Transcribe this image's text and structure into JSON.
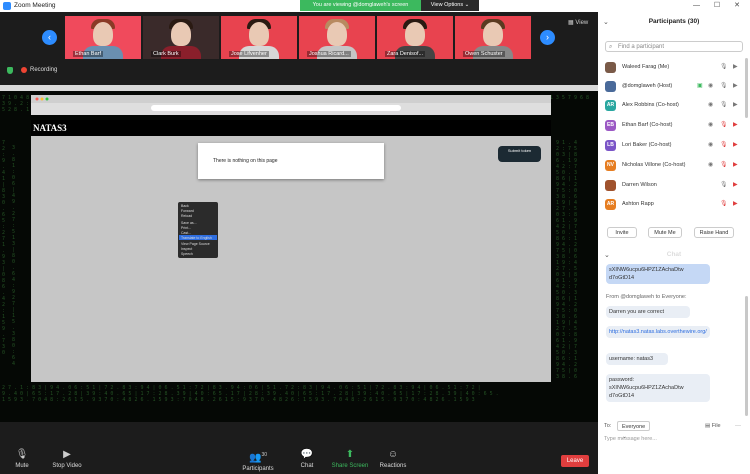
{
  "window": {
    "title": "Zoom Meeting",
    "controls": "— ☐ ✕"
  },
  "banner": {
    "viewing": "You are viewing @domglaweh's screen",
    "view_options": "View Options ⌄"
  },
  "gallery": {
    "tiles": [
      {
        "name": "Ethan Barf"
      },
      {
        "name": "Clark Burk"
      },
      {
        "name": "Jose Lifvenher"
      },
      {
        "name": "Joshua Ricard..."
      },
      {
        "name": "Zara Denisof..."
      },
      {
        "name": "Owen Schuster"
      }
    ],
    "view_label": "View"
  },
  "status": {
    "recording": "Recording"
  },
  "shared_screen": {
    "site_title": "NATAS3",
    "page_text": "There is nothing on this page",
    "submit_badge": "Submit token",
    "context_menu": [
      "Back",
      "Forward",
      "Reload",
      "Save as...",
      "Print...",
      "Cast...",
      "Translate to English",
      "View Page Source",
      "Inspect",
      "Speech"
    ]
  },
  "toolbar": {
    "mute": "Mute",
    "video": "Stop Video",
    "participants": "Participants",
    "participants_count": "30",
    "chat": "Chat",
    "share": "Share Screen",
    "reactions": "Reactions",
    "leave": "Leave"
  },
  "participants": {
    "title": "Participants (30)",
    "search_placeholder": "Find a participant",
    "list": [
      {
        "initials": "",
        "name": "Waleed Farag (Me)",
        "color": "#7a5a48"
      },
      {
        "initials": "",
        "name": "@domglaweh (Host)",
        "color": "#4a6a9a"
      },
      {
        "initials": "AR",
        "name": "Alex Robbins (Co-host)",
        "color": "#2aa7a0"
      },
      {
        "initials": "EB",
        "name": "Ethan Barf (Co-host)",
        "color": "#9b59c4"
      },
      {
        "initials": "LB",
        "name": "Lori Baker (Co-host)",
        "color": "#7b55c7"
      },
      {
        "initials": "NV",
        "name": "Nicholas Villone (Co-host)",
        "color": "#e67e22"
      },
      {
        "initials": "",
        "name": "Darren Wilson",
        "color": "#a0522d"
      },
      {
        "initials": "AR",
        "name": "Ashton Rapp",
        "color": "#e67e22"
      }
    ],
    "invite": "Invite",
    "mute_me": "Mute Me",
    "raise_hand": "Raise Hand"
  },
  "chat": {
    "title": "Chat",
    "msg1": "sXINW6ucpu6HPZ1ZAchaDtw d7oGtD14",
    "from": "From @domglaweh to Everyone:",
    "msg2": "Darren   you are correct",
    "msg3": "http://natas3.natas.labs.overthewire.org/",
    "msg4": "username: natas3",
    "msg5": "password: sXINW6ucpu6HPZ1ZAchaDtw d7oGtD14",
    "to_label": "To:",
    "to_value": "Everyone ⌄",
    "file": "File",
    "input_placeholder": "Type message here..."
  }
}
